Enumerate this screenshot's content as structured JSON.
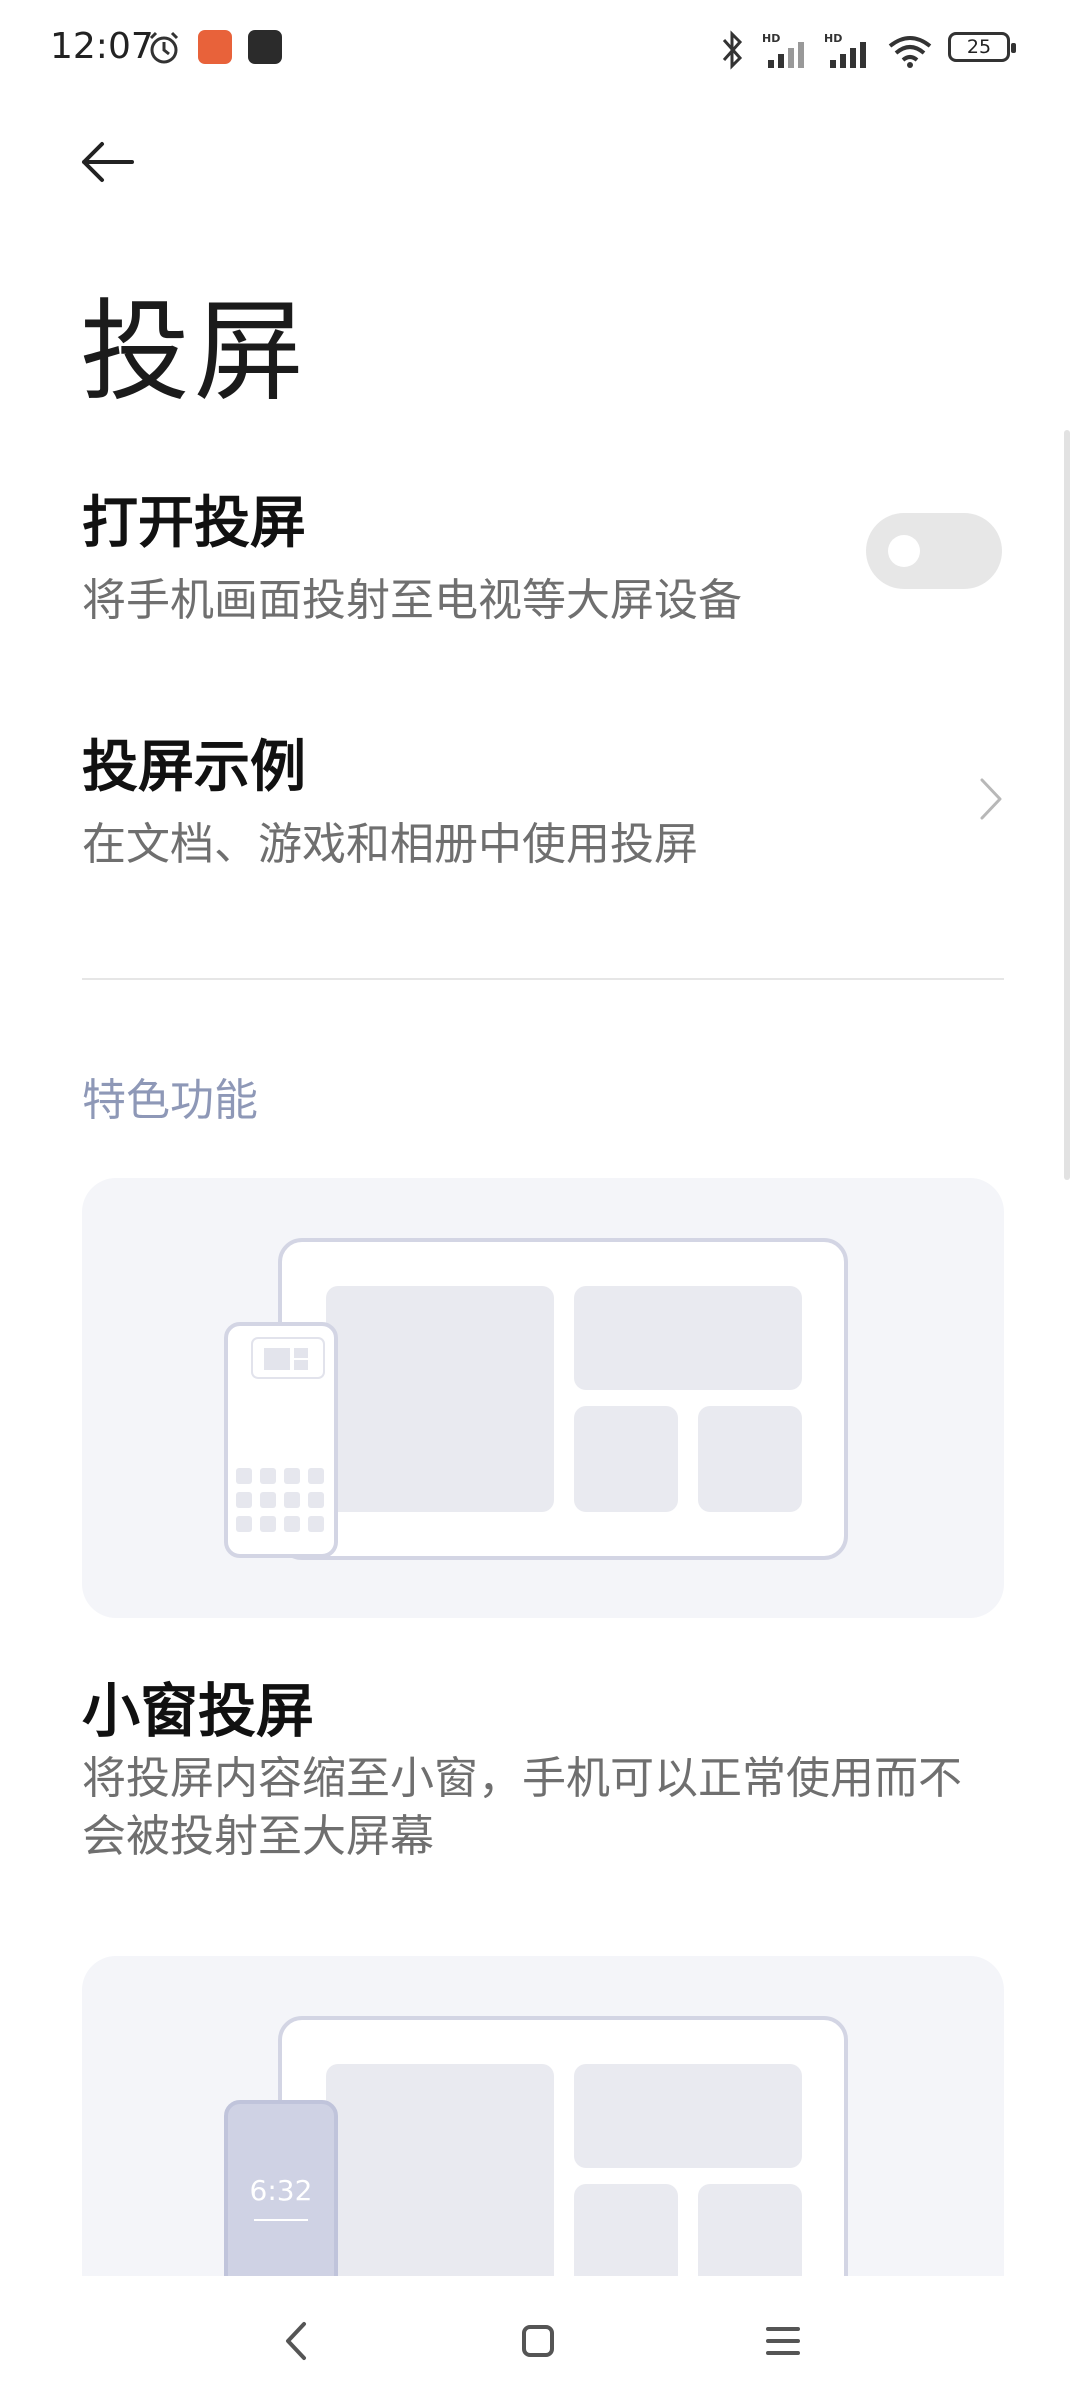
{
  "status_bar": {
    "time": "12:07",
    "battery": "25"
  },
  "header": {
    "title": "投屏"
  },
  "settings": {
    "screen_cast": {
      "title": "打开投屏",
      "subtitle": "将手机画面投射至电视等大屏设备"
    },
    "examples": {
      "title": "投屏示例",
      "subtitle": "在文档、游戏和相册中使用投屏"
    }
  },
  "section": {
    "header": "特色功能"
  },
  "features": [
    {
      "title": "小窗投屏",
      "description": "将投屏内容缩至小窗，手机可以正常使用而不会被投射至大屏幕"
    },
    {
      "illustration_time": "6:32"
    }
  ],
  "colors": {
    "accent_section": "#8e98b7",
    "card_bg": "#f4f5f9",
    "illustration_stroke": "#d3d5e4",
    "illustration_fill": "#e9eaf0"
  }
}
